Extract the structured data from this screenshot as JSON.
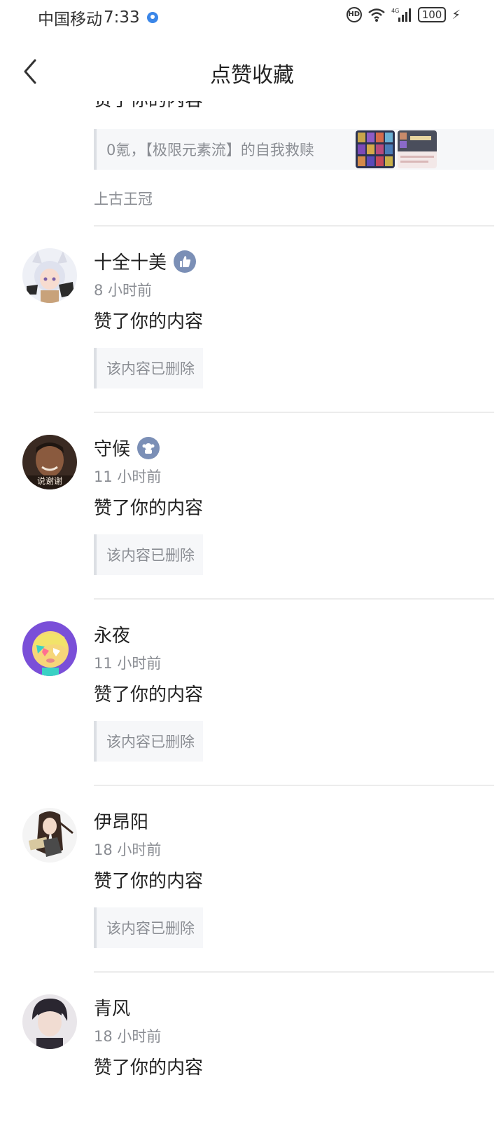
{
  "status_bar": {
    "carrier": "中国移动",
    "time": "7:33",
    "network": "4G",
    "hd": "HD",
    "battery": "100"
  },
  "header": {
    "title": "点赞收藏",
    "back_icon": "chevron-left-icon"
  },
  "partial_item": {
    "action_cut": "赞了你的内容",
    "post_title": "0氪，【极限元素流】的自我救赎",
    "topic": "上古王冠"
  },
  "items": [
    {
      "username": "十全十美",
      "badge_icon": "thumbs-up-badge-icon",
      "time": "8 小时前",
      "action": "赞了你的内容",
      "content": "该内容已删除"
    },
    {
      "username": "守候",
      "badge_icon": "mascot-badge-icon",
      "time": "11 小时前",
      "action": "赞了你的内容",
      "content": "该内容已删除",
      "avatar_caption": "说谢谢"
    },
    {
      "username": "永夜",
      "time": "11 小时前",
      "action": "赞了你的内容",
      "content": "该内容已删除"
    },
    {
      "username": "伊昂阳",
      "time": "18 小时前",
      "action": "赞了你的内容",
      "content": "该内容已删除"
    },
    {
      "username": "青风",
      "time": "18 小时前",
      "action": "赞了你的内容"
    }
  ],
  "colors": {
    "text_primary": "#222222",
    "text_secondary": "#8a8d93",
    "quote_bg": "#f6f7f9",
    "badge": "#7b8fb6"
  }
}
